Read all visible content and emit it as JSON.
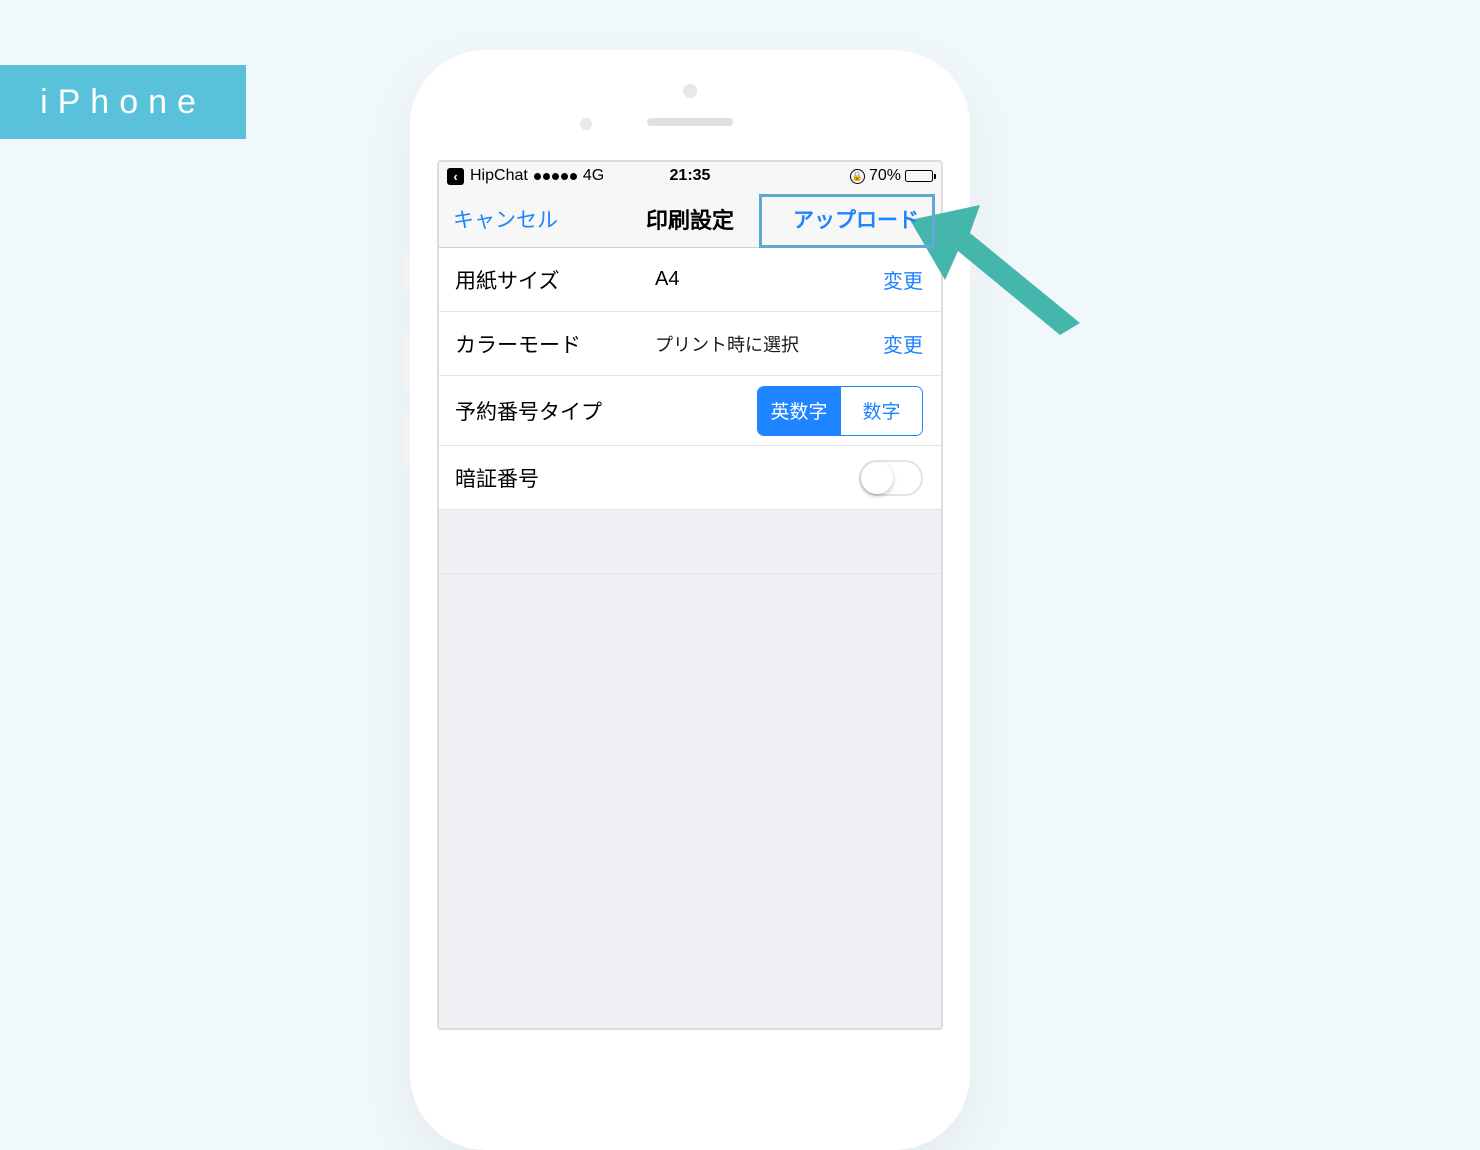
{
  "tag_label": "iPhone",
  "statusbar": {
    "back_app": "HipChat",
    "carrier_tech": "4G",
    "time": "21:35",
    "battery_pct": "70%"
  },
  "nav": {
    "cancel": "キャンセル",
    "title": "印刷設定",
    "upload": "アップロード"
  },
  "rows": {
    "paper_size": {
      "label": "用紙サイズ",
      "value": "A4",
      "change": "変更"
    },
    "color_mode": {
      "label": "カラーモード",
      "value": "プリント時に選択",
      "change": "変更"
    },
    "reservation_type": {
      "label": "予約番号タイプ",
      "option_alnum": "英数字",
      "option_num": "数字"
    },
    "pin": {
      "label": "暗証番号"
    }
  },
  "colors": {
    "accent_teal": "#44b6ac",
    "ios_blue": "#1f84ff",
    "tag_blue": "#5ac1da",
    "highlight_border": "#5faad2"
  }
}
